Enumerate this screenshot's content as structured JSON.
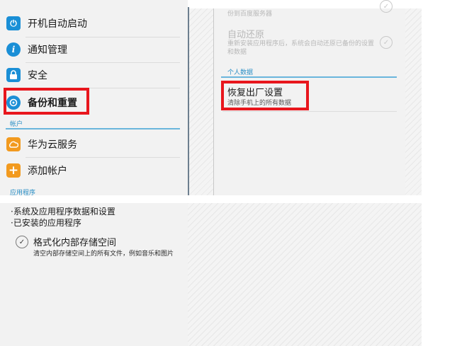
{
  "settings_list": {
    "items": [
      {
        "label": "开机自动启动",
        "icon": "power-on-icon",
        "color": "#1a8fd6",
        "glyph": "⏻"
      },
      {
        "label": "通知管理",
        "icon": "info-icon",
        "color": "#1a8fd6",
        "glyph": "i"
      },
      {
        "label": "安全",
        "icon": "lock-icon",
        "color": "#1a8fd6",
        "glyph": "🔒"
      },
      {
        "label": "备份和重置",
        "icon": "backup-icon",
        "color": "#1a8fd6",
        "glyph": "↺"
      }
    ],
    "section_accounts": "帐户",
    "account_items": [
      {
        "label": "华为云服务",
        "icon": "cloud-icon",
        "color": "#f29a1f",
        "glyph": "☁"
      },
      {
        "label": "添加帐户",
        "icon": "add-icon",
        "color": "#f29a1f",
        "glyph": "+"
      }
    ],
    "section_apps": "应用程序"
  },
  "detail_pane": {
    "faded_top_line": "份到百度服务器",
    "auto_restore_title": "自动还原",
    "auto_restore_desc": "重新安装应用程序后，系统会自动还原已备份的设置和数据",
    "section_personal": "个人数据",
    "factory_reset_title": "恢复出厂设置",
    "factory_reset_desc": "清除手机上的所有数据"
  },
  "reset_info": {
    "bullets": [
      "·系统及应用程序数据和设置",
      "·已安装的应用程序"
    ],
    "format_title": "格式化内部存储空间",
    "format_desc": "清空内部存储空间上的所有文件，例如音乐和图片"
  },
  "colors": {
    "highlight": "#e8161d",
    "accent": "#2a8fc6"
  }
}
